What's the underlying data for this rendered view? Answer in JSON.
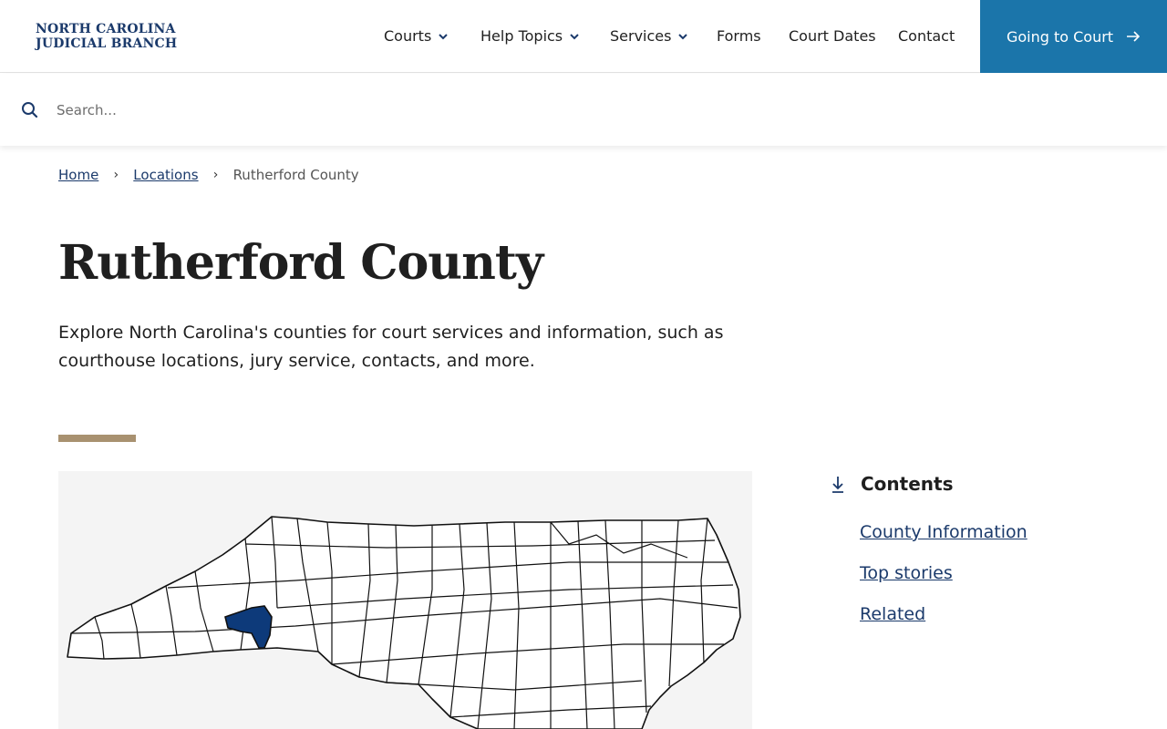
{
  "header": {
    "logo_line1": "NORTH CAROLINA",
    "logo_line2": "JUDICIAL BRANCH",
    "nav": [
      {
        "label": "Courts",
        "has_dropdown": true
      },
      {
        "label": "Help Topics",
        "has_dropdown": true
      },
      {
        "label": "Services",
        "has_dropdown": true
      },
      {
        "label": "Forms",
        "has_dropdown": false
      },
      {
        "label": "Court Dates",
        "has_dropdown": false
      },
      {
        "label": "Contact",
        "has_dropdown": false
      }
    ],
    "cta_label": "Going to Court",
    "cta_icon": "arrow-right-icon",
    "cta_color": "#1b75aa"
  },
  "search": {
    "placeholder": "Search...",
    "value": "",
    "icon": "search-icon"
  },
  "breadcrumb": {
    "items": [
      "Home",
      "Locations"
    ],
    "current": "Rutherford County"
  },
  "page": {
    "title": "Rutherford County",
    "intro": "Explore North Carolina's counties for court services and information, such as courthouse locations, jury service, contacts, and more.",
    "accent_color": "#a89170"
  },
  "map": {
    "highlighted_county": "Rutherford County",
    "highlight_color": "#0d3a7a"
  },
  "contents": {
    "heading": "Contents",
    "icon": "arrow-down-to-line-icon",
    "links": [
      "County Information",
      "Top stories",
      "Related"
    ]
  }
}
